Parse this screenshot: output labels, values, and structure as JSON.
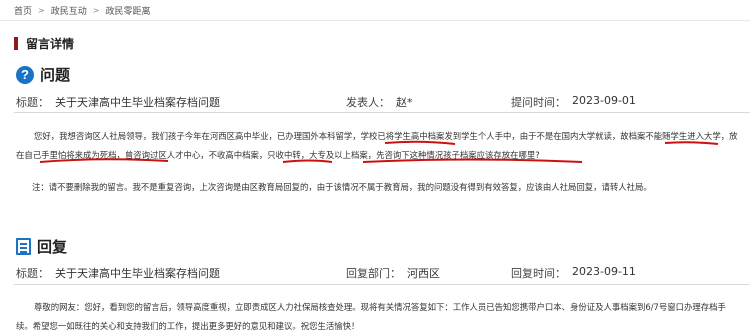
{
  "breadcrumb": {
    "home": "首页",
    "item1": "政民互动",
    "item2": "政民零距离",
    "separator": ">"
  },
  "section": {
    "title": "留言详情"
  },
  "question": {
    "heading": "问题",
    "title_label": "标题：",
    "title": "关于天津高中生毕业档案存档问题",
    "author_label": "发表人：",
    "author": "赵*",
    "time_label": "提问时间：",
    "time": "2023-09-01",
    "content": "您好，我想咨询区人社局领导，我们孩子今年在河西区高中毕业，已办理国外本科留学，学校已将学生高中档案发到学生个人手中，由于不是在国内大学就读，故档案不能随学生进入大学，放在自己手里怕将来成为死档，曾咨询过区人才中心，不收高中档案，只收中转，大专及以上档案，先咨询下这种情况孩子档案应该存放在哪里?",
    "note": "注：请不要删除我的留言。我不是重复咨询，上次咨询是由区教育局回复的，由于该情况不属于教育局，我的问题没有得到有效答复，应该由人社局回复，请转人社局。"
  },
  "reply": {
    "heading": "回复",
    "title_label": "标题：",
    "title": "关于天津高中生毕业档案存档问题",
    "dept_label": "回复部门：",
    "dept": "河西区",
    "time_label": "回复时间：",
    "time": "2023-09-11",
    "content": "尊敬的网友：您好，看到您的留言后，领导高度重视，立即责成区人力社保局核查处理。现将有关情况答复如下：工作人员已告知您携带户口本、身份证及人事档案到6/7号窗口办理存档手续。希望您一如既往的关心和支持我们的工作，提出更多更好的意见和建议。祝您生活愉快！"
  },
  "colors": {
    "accent_bar": "#8a1d1d",
    "icon_blue": "#1a73c7",
    "ink_red": "#cc1111"
  },
  "icons": {
    "question": "question-circle-icon",
    "reply": "edit-document-icon"
  }
}
